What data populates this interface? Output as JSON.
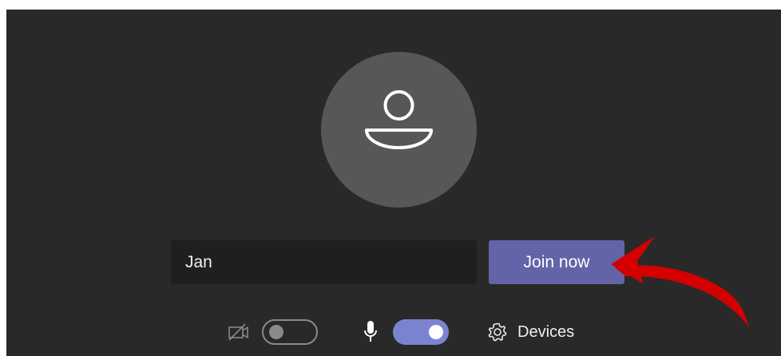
{
  "prejoin": {
    "avatar_icon": "person-icon",
    "name_value": "Jan",
    "join_label": "Join now"
  },
  "controls": {
    "camera": {
      "icon": "camera-off-icon",
      "enabled": false
    },
    "microphone": {
      "icon": "microphone-icon",
      "enabled": true
    },
    "devices": {
      "icon": "gear-icon",
      "label": "Devices"
    }
  },
  "annotation": {
    "type": "red-arrow",
    "color": "#d40000"
  },
  "colors": {
    "background": "#292929",
    "avatar": "#575757",
    "input": "#1f1f1f",
    "accent": "#6264a7",
    "toggle_on": "#7b83d1"
  }
}
